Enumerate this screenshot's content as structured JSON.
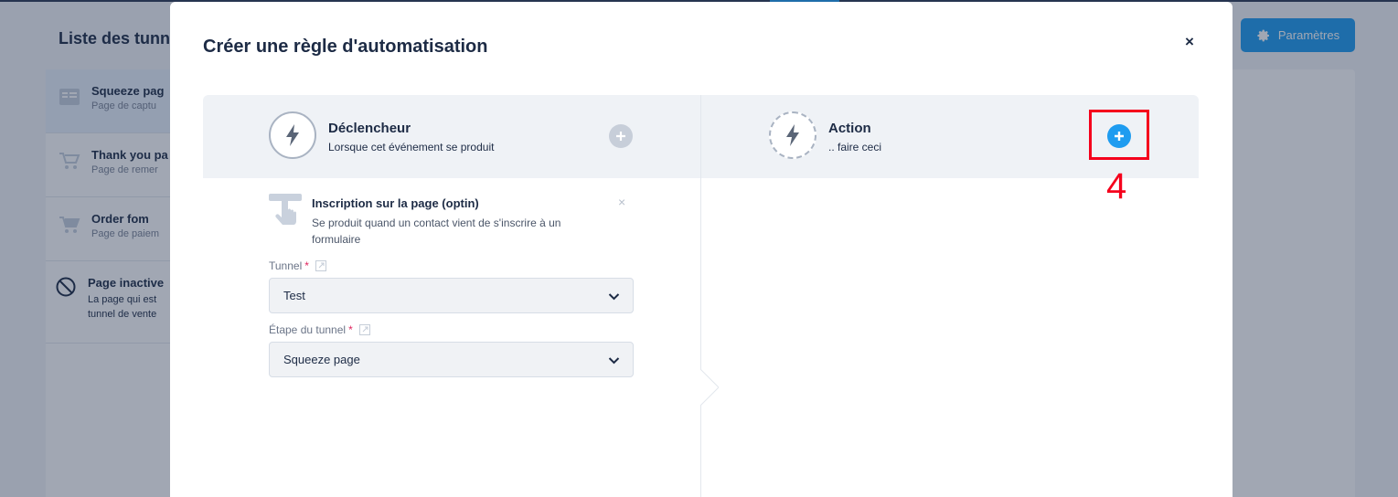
{
  "background": {
    "title": "Liste des tunn",
    "settings_label": "Paramètres",
    "items": [
      {
        "title": "Squeeze pag",
        "subtitle": "Page de captu"
      },
      {
        "title": "Thank you pa",
        "subtitle": "Page de remer"
      },
      {
        "title": "Order fom",
        "subtitle": "Page de paiem"
      },
      {
        "title": "Page inactive",
        "subtitle": "La page qui est tunnel de vente"
      }
    ]
  },
  "modal": {
    "title": "Créer une règle d'automatisation",
    "close_label": "×",
    "trigger_header": {
      "title": "Déclencheur",
      "subtitle": "Lorsque cet événement se produit"
    },
    "action_header": {
      "title": "Action",
      "subtitle": ".. faire ceci"
    },
    "annotation_number": "4",
    "trigger": {
      "title": "Inscription sur la page (optin)",
      "description": "Se produit quand un contact vient de s'inscrire à un formulaire",
      "close_label": "×"
    },
    "fields": [
      {
        "label": "Tunnel",
        "required_mark": "*",
        "value": "Test"
      },
      {
        "label": "Étape du tunnel",
        "required_mark": "*",
        "value": "Squeeze page"
      }
    ]
  },
  "colors": {
    "accent": "#1e9cf0",
    "annotation": "#f5001c",
    "text": "#1d2b45"
  }
}
